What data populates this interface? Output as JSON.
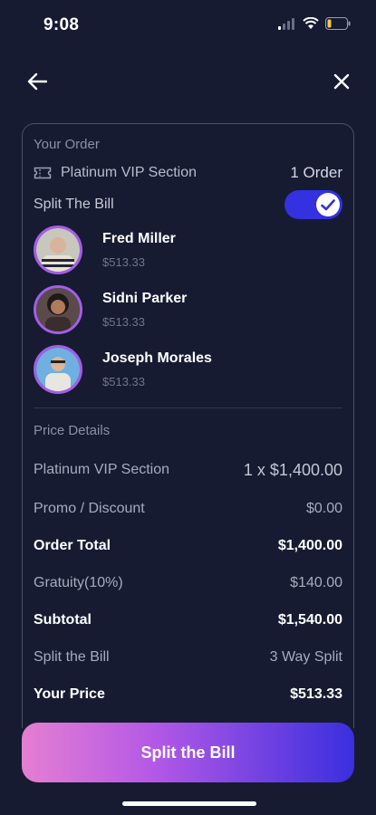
{
  "status_bar": {
    "time": "9:08"
  },
  "order": {
    "section_title": "Your Order",
    "item_name": "Platinum VIP Section",
    "count": "1 Order",
    "split_label": "Split The Bill",
    "split_enabled": true
  },
  "people": [
    {
      "name": "Fred Miller",
      "amount": "$513.33"
    },
    {
      "name": "Sidni Parker",
      "amount": "$513.33"
    },
    {
      "name": "Joseph Morales",
      "amount": "$513.33"
    }
  ],
  "price_details": {
    "title": "Price Details",
    "rows": [
      {
        "label": "Platinum VIP Section",
        "value": "1 x $1,400.00",
        "bold": false
      },
      {
        "label": "Promo / Discount",
        "value": "$0.00",
        "bold": false
      },
      {
        "label": "Order Total",
        "value": "$1,400.00",
        "bold": true
      },
      {
        "label": "Gratuity(10%)",
        "value": "$140.00",
        "bold": false
      },
      {
        "label": "Subtotal",
        "value": "$1,540.00",
        "bold": true
      },
      {
        "label": "Split the Bill",
        "value": "3 Way Split",
        "bold": false
      },
      {
        "label": "Your Price",
        "value": "$513.33",
        "bold": true
      }
    ]
  },
  "cta": {
    "label": "Split the Bill"
  },
  "colors": {
    "background": "#161b32",
    "accent": "#3431e0",
    "avatar_ring": "#a45de8"
  }
}
